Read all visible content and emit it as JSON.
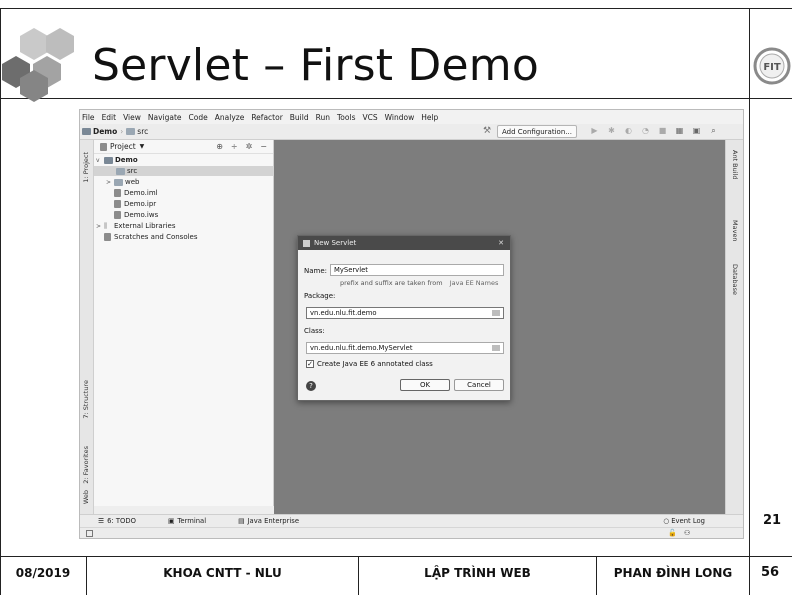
{
  "slide": {
    "title": "Servlet – First Demo",
    "side_number_top": "21",
    "logo_text": "FIT"
  },
  "footer": {
    "date": "08/2019",
    "faculty": "KHOA CNTT - NLU",
    "course": "LẬP TRÌNH WEB",
    "author": "PHAN ĐÌNH LONG",
    "page": "56"
  },
  "ide": {
    "menu": [
      "File",
      "Edit",
      "View",
      "Navigate",
      "Code",
      "Analyze",
      "Refactor",
      "Build",
      "Run",
      "Tools",
      "VCS",
      "Window",
      "Help"
    ],
    "breadcrumb": [
      "Demo",
      "src"
    ],
    "add_configuration": "Add Configuration...",
    "project_panel_title": "Project",
    "tree": [
      {
        "label": "Demo",
        "arrow": "v"
      },
      {
        "label": "src",
        "arrow": ""
      },
      {
        "label": "web",
        "arrow": ">"
      },
      {
        "label": "Demo.iml",
        "arrow": ""
      },
      {
        "label": "Demo.ipr",
        "arrow": ""
      },
      {
        "label": "Demo.iws",
        "arrow": ""
      },
      {
        "label": "External Libraries",
        "arrow": ">"
      },
      {
        "label": "Scratches and Consoles",
        "arrow": ""
      }
    ],
    "left_tabs": [
      "1: Project",
      "7: Structure",
      "2: Favorites",
      "Web"
    ],
    "right_tabs": [
      "Ant Build",
      "Maven",
      "Database"
    ],
    "bottom_tabs": [
      "6: TODO",
      "Terminal",
      "Java Enterprise"
    ],
    "event_log": "Event Log"
  },
  "dialog": {
    "title": "New Servlet",
    "close": "✕",
    "name_label": "Name:",
    "name_value": "MyServlet",
    "hint": "prefix and suffix are taken from",
    "hint_link": "Java EE Names",
    "package_label": "Package:",
    "package_value": "vn.edu.nlu.fit.demo",
    "class_label": "Class:",
    "class_value": "vn.edu.nlu.fit.demo.MyServlet",
    "checkbox_label": "Create Java EE 6 annotated class",
    "checkbox_checked": true,
    "ok": "OK",
    "cancel": "Cancel",
    "help": "?"
  }
}
